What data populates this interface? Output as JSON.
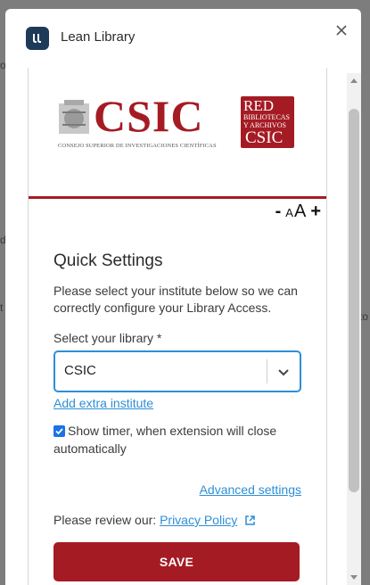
{
  "app": {
    "title": "Lean Library"
  },
  "logos": {
    "csic_word": "CSIC",
    "csic_subtitle": "CONSEJO SUPERIOR DE INVESTIGACIONES CIENTÍFICAS",
    "red_word": "RED",
    "red_line1": "BIBLIOTECAS",
    "red_line2": "Y ARCHIVOS",
    "red_word2": "CSIC"
  },
  "font_controls": {
    "decrease": "-",
    "small_a": "A",
    "large_a": "A",
    "increase": "+"
  },
  "quick_settings": {
    "title": "Quick Settings",
    "description": "Please select your institute below so we can correctly configure your Library Access.",
    "library_label": "Select your library *",
    "library_value": "CSIC",
    "add_institute": "Add extra institute",
    "timer_label": "Show timer, when extension will close automatically",
    "timer_checked": true,
    "advanced_settings": "Advanced settings",
    "privacy_prefix": "Please review our:",
    "privacy_link": "Privacy Policy",
    "save": "SAVE"
  },
  "colors": {
    "brand_red": "#a51b24",
    "link_blue": "#2d8fd6",
    "logo_navy": "#1d3a58"
  }
}
